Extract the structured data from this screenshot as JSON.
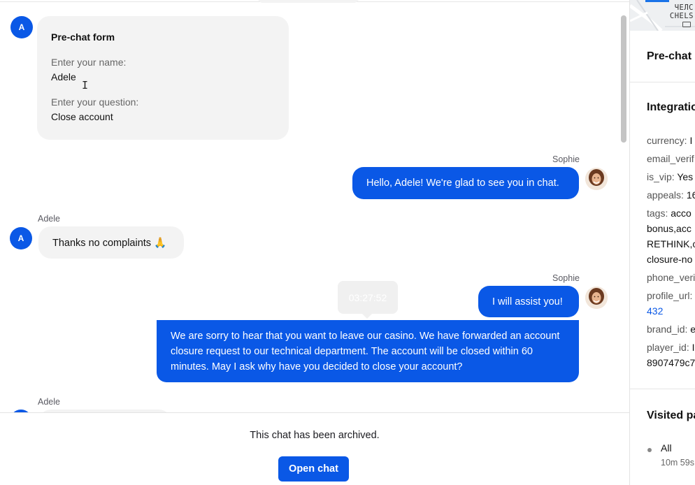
{
  "prechat_form": {
    "title": "Pre-chat form",
    "fields": [
      {
        "label": "Enter your name:",
        "value": "Adele"
      },
      {
        "label": "Enter your question:",
        "value": "Close account"
      }
    ]
  },
  "messages": [
    {
      "sender": "Sophie",
      "text": "Hello, Adele! We're glad to see you in chat."
    },
    {
      "sender": "Adele",
      "text": "Thanks no complaints 🙏"
    },
    {
      "sender": "Sophie",
      "text": "I will assist you!"
    },
    {
      "text": "We are sorry to hear that you want to leave our casino. We have forwarded an account closure request to our technical department. The account will be closed within 60 minutes. May I ask why have you decided to close your account?"
    },
    {
      "sender": "Adele"
    }
  ],
  "avatar_initial": "A",
  "tooltip_time": "03:27:52",
  "archive": {
    "text": "This chat has been archived.",
    "button": "Open chat"
  },
  "sidebar": {
    "map_labels": [
      "ЧЕЛС",
      "CHELS"
    ],
    "prechat_heading": "Pre-chat",
    "integration_heading": "Integratio",
    "fields": [
      {
        "key": "currency:",
        "value": "I"
      },
      {
        "key": "email_verif",
        "value": ""
      },
      {
        "key": "is_vip:",
        "value": "Yes"
      },
      {
        "key": "appeals:",
        "value": "16"
      },
      {
        "key": "tags:",
        "value": "acco"
      },
      {
        "key": "",
        "value": "bonus,acc"
      },
      {
        "key": "",
        "value": "RETHINK,c"
      },
      {
        "key": "",
        "value": "closure-no"
      },
      {
        "key": "phone_veri",
        "value": ""
      },
      {
        "key": "profile_url:",
        "value": ""
      },
      {
        "key": "",
        "value": "432"
      },
      {
        "key": "brand_id:",
        "value": "e"
      },
      {
        "key": "player_id:",
        "value": "I"
      },
      {
        "key": "",
        "value": "8907479c7"
      }
    ],
    "visited_heading": "Visited pa",
    "visited_item": "All",
    "visited_time": "10m 59s"
  },
  "colors": {
    "accent": "#0a58e6",
    "bubble_in": "#f3f3f3"
  }
}
